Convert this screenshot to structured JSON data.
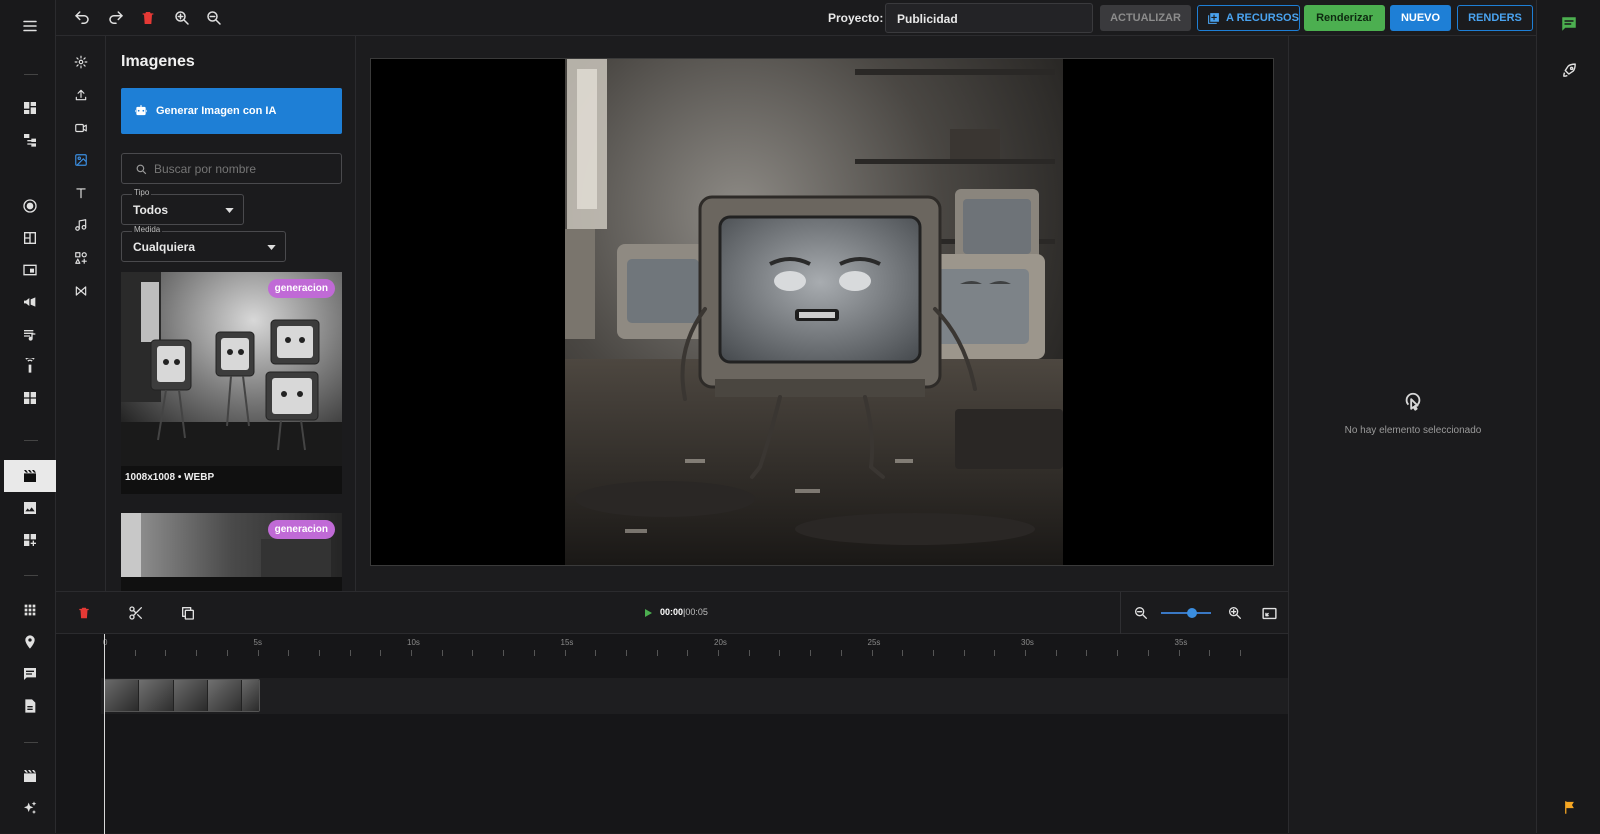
{
  "topbar": {
    "project_label": "Proyecto:",
    "project_value": "Publicidad",
    "btn_update": "ACTUALIZAR",
    "btn_resources": "A RECURSOS",
    "btn_render": "Renderizar",
    "btn_new": "NUEVO",
    "btn_renders": "RENDERS"
  },
  "panel": {
    "title": "Imagenes",
    "generate_btn": "Generar Imagen con IA",
    "search_placeholder": "Buscar por nombre",
    "tipo_label": "Tipo",
    "tipo_value": "Todos",
    "medida_label": "Medida",
    "medida_value": "Cualquiera",
    "cards": [
      {
        "badge": "generacion",
        "meta": "1008x1008 • WEBP"
      },
      {
        "badge": "generacion",
        "meta": ""
      }
    ]
  },
  "inspector": {
    "empty_text": "No hay elemento seleccionado"
  },
  "timeline": {
    "current_time": "00:00",
    "separator": "|",
    "total_time": "00:05",
    "ruler_labels": [
      "0",
      "5s",
      "10s",
      "15s",
      "20s",
      "25s",
      "30s",
      "35s"
    ]
  },
  "colors": {
    "accent_blue": "#1e7fd6",
    "render_green": "#4caf50",
    "badge_purple": "#c06ad6",
    "delete_red": "#e53935",
    "flag_orange": "#f5a623",
    "chat_green": "#4caf50"
  }
}
